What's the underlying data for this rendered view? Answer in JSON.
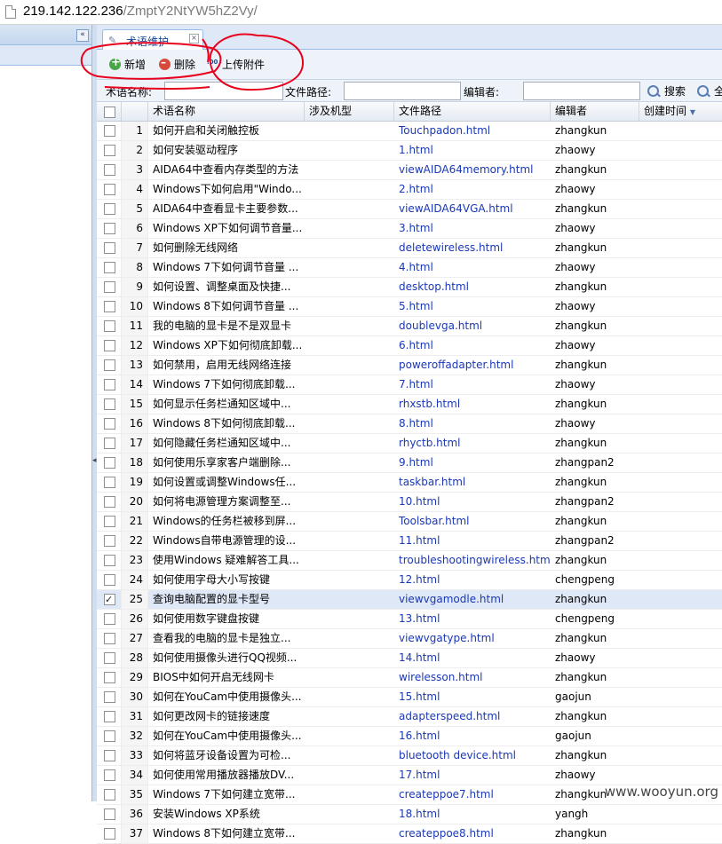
{
  "address_bar": {
    "host": "219.142.122.236",
    "path": "/ZmptY2NtYW5hZ2Vy/"
  },
  "tab": {
    "label": "术语维护"
  },
  "toolbar": {
    "add_label": "新增",
    "delete_label": "删除",
    "upload_label": "上传附件",
    "upload_icon_text": ".00"
  },
  "filter": {
    "name_label": "术语名称:",
    "path_label": "文件路径:",
    "editor_label": "编辑者:",
    "name_value": "",
    "path_value": "",
    "editor_value": "",
    "search_label": "搜索",
    "all_label": "全"
  },
  "columns": {
    "name": "术语名称",
    "model": "涉及机型",
    "path": "文件路径",
    "editor": "编辑者",
    "created": "创建时间"
  },
  "rows": [
    {
      "num": "1",
      "name": "如何开启和关闭触控板",
      "path": "Touchpadon.html",
      "editor": "zhangkun",
      "checked": false
    },
    {
      "num": "2",
      "name": "如何安装驱动程序",
      "path": "1.html",
      "editor": "zhaowy",
      "checked": false
    },
    {
      "num": "3",
      "name": "AIDA64中查看内存类型的方法",
      "path": "viewAIDA64memory.html",
      "editor": "zhangkun",
      "checked": false
    },
    {
      "num": "4",
      "name": "Windows下如何启用\"Windo...",
      "path": "2.html",
      "editor": "zhaowy",
      "checked": false
    },
    {
      "num": "5",
      "name": "AIDA64中查看显卡主要参数...",
      "path": "viewAIDA64VGA.html",
      "editor": "zhangkun",
      "checked": false
    },
    {
      "num": "6",
      "name": "Windows XP下如何调节音量...",
      "path": "3.html",
      "editor": "zhaowy",
      "checked": false
    },
    {
      "num": "7",
      "name": "如何删除无线网络",
      "path": "deletewireless.html",
      "editor": "zhangkun",
      "checked": false
    },
    {
      "num": "8",
      "name": "Windows 7下如何调节音量 ...",
      "path": "4.html",
      "editor": "zhaowy",
      "checked": false
    },
    {
      "num": "9",
      "name": "如何设置、调整桌面及快捷...",
      "path": "desktop.html",
      "editor": "zhangkun",
      "checked": false
    },
    {
      "num": "10",
      "name": "Windows 8下如何调节音量 ...",
      "path": "5.html",
      "editor": "zhaowy",
      "checked": false
    },
    {
      "num": "11",
      "name": "我的电脑的显卡是不是双显卡",
      "path": "doublevga.html",
      "editor": "zhangkun",
      "checked": false
    },
    {
      "num": "12",
      "name": "Windows XP下如何彻底卸载...",
      "path": "6.html",
      "editor": "zhaowy",
      "checked": false
    },
    {
      "num": "13",
      "name": "如何禁用，启用无线网络连接",
      "path": "poweroffadapter.html",
      "editor": "zhangkun",
      "checked": false
    },
    {
      "num": "14",
      "name": "Windows 7下如何彻底卸载...",
      "path": "7.html",
      "editor": "zhaowy",
      "checked": false
    },
    {
      "num": "15",
      "name": "如何显示任务栏通知区域中...",
      "path": "rhxstb.html",
      "editor": "zhangkun",
      "checked": false
    },
    {
      "num": "16",
      "name": "Windows 8下如何彻底卸载...",
      "path": "8.html",
      "editor": "zhaowy",
      "checked": false
    },
    {
      "num": "17",
      "name": "如何隐藏任务栏通知区域中...",
      "path": "rhyctb.html",
      "editor": "zhangkun",
      "checked": false
    },
    {
      "num": "18",
      "name": "如何使用乐享家客户端删除...",
      "path": "9.html",
      "editor": "zhangpan2",
      "checked": false
    },
    {
      "num": "19",
      "name": "如何设置或调整Windows任...",
      "path": "taskbar.html",
      "editor": "zhangkun",
      "checked": false
    },
    {
      "num": "20",
      "name": "如何将电源管理方案调整至...",
      "path": "10.html",
      "editor": "zhangpan2",
      "checked": false
    },
    {
      "num": "21",
      "name": "Windows的任务栏被移到屏...",
      "path": "Toolsbar.html",
      "editor": "zhangkun",
      "checked": false
    },
    {
      "num": "22",
      "name": "Windows自带电源管理的设...",
      "path": "11.html",
      "editor": "zhangpan2",
      "checked": false
    },
    {
      "num": "23",
      "name": "使用Windows 疑难解答工具...",
      "path": "troubleshootingwireless.html",
      "editor": "zhangkun",
      "checked": false
    },
    {
      "num": "24",
      "name": "如何使用字母大小写按键",
      "path": "12.html",
      "editor": "chengpeng",
      "checked": false
    },
    {
      "num": "25",
      "name": "查询电脑配置的显卡型号",
      "path": "viewvgamodle.html",
      "editor": "zhangkun",
      "checked": true
    },
    {
      "num": "26",
      "name": "如何使用数字键盘按键",
      "path": "13.html",
      "editor": "chengpeng",
      "checked": false
    },
    {
      "num": "27",
      "name": "查看我的电脑的显卡是独立...",
      "path": "viewvgatype.html",
      "editor": "zhangkun",
      "checked": false
    },
    {
      "num": "28",
      "name": "如何使用摄像头进行QQ视频...",
      "path": "14.html",
      "editor": "zhaowy",
      "checked": false
    },
    {
      "num": "29",
      "name": "BIOS中如何开启无线网卡",
      "path": "wirelesson.html",
      "editor": "zhangkun",
      "checked": false
    },
    {
      "num": "30",
      "name": "如何在YouCam中使用摄像头...",
      "path": "15.html",
      "editor": "gaojun",
      "checked": false
    },
    {
      "num": "31",
      "name": "如何更改网卡的链接速度",
      "path": "adapterspeed.html",
      "editor": "zhangkun",
      "checked": false
    },
    {
      "num": "32",
      "name": "如何在YouCam中使用摄像头...",
      "path": "16.html",
      "editor": "gaojun",
      "checked": false
    },
    {
      "num": "33",
      "name": "如何将蓝牙设备设置为可检...",
      "path": "bluetooth device.html",
      "editor": "zhangkun",
      "checked": false
    },
    {
      "num": "34",
      "name": "如何使用常用播放器播放DV...",
      "path": "17.html",
      "editor": "zhaowy",
      "checked": false
    },
    {
      "num": "35",
      "name": "Windows 7下如何建立宽带...",
      "path": "createppoe7.html",
      "editor": "zhangkun",
      "checked": false
    },
    {
      "num": "36",
      "name": "安装Windows XP系统",
      "path": "18.html",
      "editor": "yangh",
      "checked": false
    },
    {
      "num": "37",
      "name": "Windows 8下如何建立宽带...",
      "path": "createppoe8.html",
      "editor": "zhangkun",
      "checked": false
    }
  ],
  "watermark": "www.wooyun.org",
  "colors": {
    "annotation": "#e8001c",
    "link": "#1b38b6",
    "selected_row": "#dfe8f6"
  }
}
